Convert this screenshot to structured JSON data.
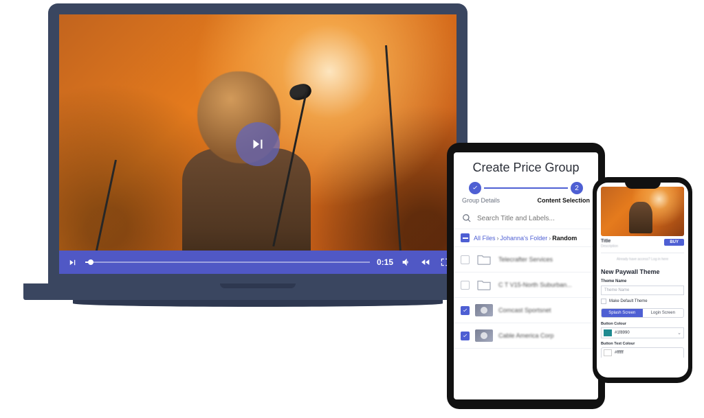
{
  "laptop": {
    "video": {
      "time_display": "0:15"
    }
  },
  "tablet": {
    "title": "Create Price Group",
    "steps": {
      "one_label": "Group Details",
      "two_num": "2",
      "two_label": "Content Selection"
    },
    "search": {
      "placeholder": "Search Title and Labels..."
    },
    "breadcrumb": {
      "seg1": "All Files",
      "seg2": "Johanna's Folder",
      "seg3": "Random"
    },
    "rows": [
      {
        "type": "folder",
        "checked": false,
        "name": "Telecrafter Services"
      },
      {
        "type": "folder",
        "checked": false,
        "name": "C T V15-North Suburban..."
      },
      {
        "type": "video",
        "checked": true,
        "name": "Comcast Sportsnet"
      },
      {
        "type": "video",
        "checked": true,
        "name": "Cable America Corp"
      }
    ]
  },
  "phone": {
    "paywall_card": {
      "title": "Title",
      "desc": "Description",
      "buy": "BUY"
    },
    "login_line": "Already have access? Log in here",
    "section_title": "New Paywall Theme",
    "theme_name_label": "Theme Name",
    "theme_name_placeholder": "Theme Name",
    "default_label": "Make Default Theme",
    "toggle": {
      "splash": "Splash Screen",
      "login": "Login Screen"
    },
    "button_colour_label": "Button Colour",
    "button_colour_value": "#1f8990",
    "button_text_colour_label": "Button Text Colour",
    "button_text_colour_value": "#ffffff"
  }
}
